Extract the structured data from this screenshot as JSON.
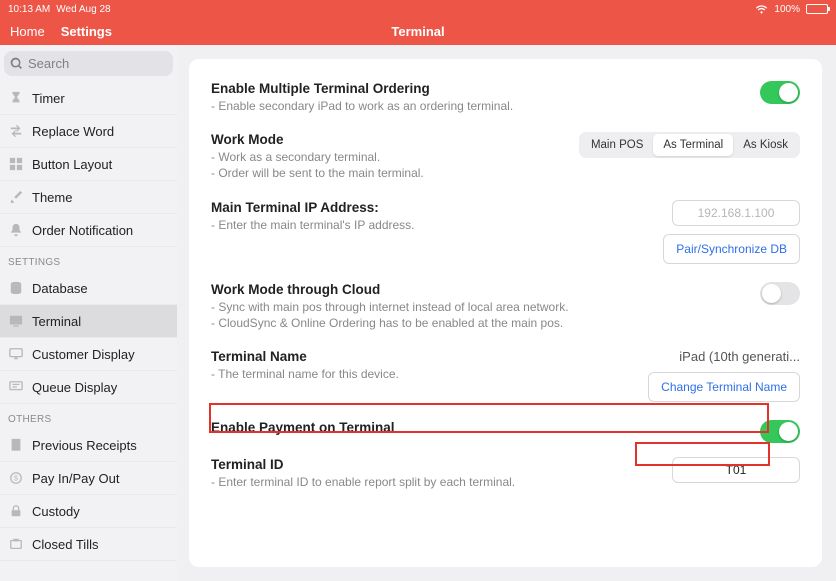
{
  "status": {
    "time": "10:13 AM",
    "date": "Wed Aug 28",
    "battery_pct": "100%"
  },
  "nav": {
    "home": "Home",
    "settings": "Settings",
    "title": "Terminal"
  },
  "search": {
    "placeholder": "Search"
  },
  "sidebar": {
    "group_top": [
      {
        "label": "Timer"
      },
      {
        "label": "Replace Word"
      },
      {
        "label": "Button Layout"
      },
      {
        "label": "Theme"
      },
      {
        "label": "Order Notification"
      }
    ],
    "section_settings": "SETTINGS",
    "group_settings": [
      {
        "label": "Database"
      },
      {
        "label": "Terminal",
        "selected": true
      },
      {
        "label": "Customer Display"
      },
      {
        "label": "Queue Display"
      }
    ],
    "section_others": "OTHERS",
    "group_others": [
      {
        "label": "Previous Receipts"
      },
      {
        "label": "Pay In/Pay Out"
      },
      {
        "label": "Custody"
      },
      {
        "label": "Closed Tills"
      }
    ]
  },
  "settings": {
    "multi_terminal": {
      "title": "Enable Multiple Terminal Ordering",
      "desc": "- Enable secondary iPad to work as an ordering terminal.",
      "enabled": true
    },
    "work_mode": {
      "title": "Work Mode",
      "desc1": "- Work as a secondary terminal.",
      "desc2": "- Order will be sent to the main terminal.",
      "options": [
        "Main POS",
        "As Terminal",
        "As Kiosk"
      ],
      "selected": "As Terminal"
    },
    "main_ip": {
      "title": "Main Terminal IP Address:",
      "desc": "- Enter the main terminal's IP address.",
      "placeholder": "192.168.1.100",
      "pair_btn": "Pair/Synchronize DB"
    },
    "cloud": {
      "title": "Work Mode through Cloud",
      "desc1": "- Sync with main pos through internet instead of local area network.",
      "desc2": "- CloudSync & Online Ordering has to be enabled at the main pos.",
      "enabled": false
    },
    "terminal_name": {
      "title": "Terminal Name",
      "desc": "- The terminal name for this device.",
      "value": "iPad (10th generati...",
      "change_btn": "Change Terminal Name"
    },
    "enable_payment": {
      "title": "Enable Payment on Terminal",
      "enabled": true
    },
    "terminal_id": {
      "title": "Terminal ID",
      "desc": "- Enter terminal ID to enable report split by each terminal.",
      "value": "T01"
    }
  }
}
